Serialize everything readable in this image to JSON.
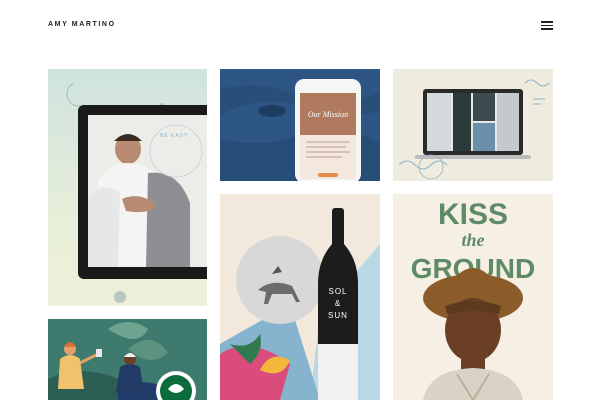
{
  "header": {
    "logo": "AMY MARTINO",
    "menu_icon": "hamburger-icon"
  },
  "tiles": [
    {
      "id": "tile-1",
      "icons": [
        "moon-icon",
        "laptop-screen",
        "couple-hug-photo",
        "stamp-icon"
      ],
      "circle_text": "BE EASY",
      "colors": {
        "bg": "#cfe3df",
        "frame": "#1a1a1a"
      }
    },
    {
      "id": "tile-2",
      "icons": [
        "phone-mockup",
        "denim-texture"
      ],
      "phone_title": "Our Mission",
      "colors": {
        "bg": "#2f5b87",
        "accent": "#e58a4a"
      }
    },
    {
      "id": "tile-3",
      "icons": [
        "laptop-mockup",
        "wave-doodle"
      ],
      "colors": {
        "bg": "#efebdf"
      }
    },
    {
      "id": "tile-4",
      "icons": [
        "wine-bottle",
        "horse-rider-circle",
        "tropical-collage"
      ],
      "bottle_line1": "SOL",
      "bottle_line2": "&",
      "bottle_line3": "SUN",
      "colors": {
        "bg": "#f1e7da",
        "bottle": "#1c1c1c"
      }
    },
    {
      "id": "tile-5",
      "icons": [
        "man-with-hat-portrait"
      ],
      "headline_top": "KISS",
      "headline_mid": "the",
      "headline_bottom": "GROUND",
      "colors": {
        "bg": "#f5f0e3",
        "text": "#5f8a66"
      }
    },
    {
      "id": "tile-6",
      "icons": [
        "illustration-people",
        "coffee-brand-logo"
      ],
      "colors": {
        "bg": "#3e7a6e"
      }
    }
  ]
}
